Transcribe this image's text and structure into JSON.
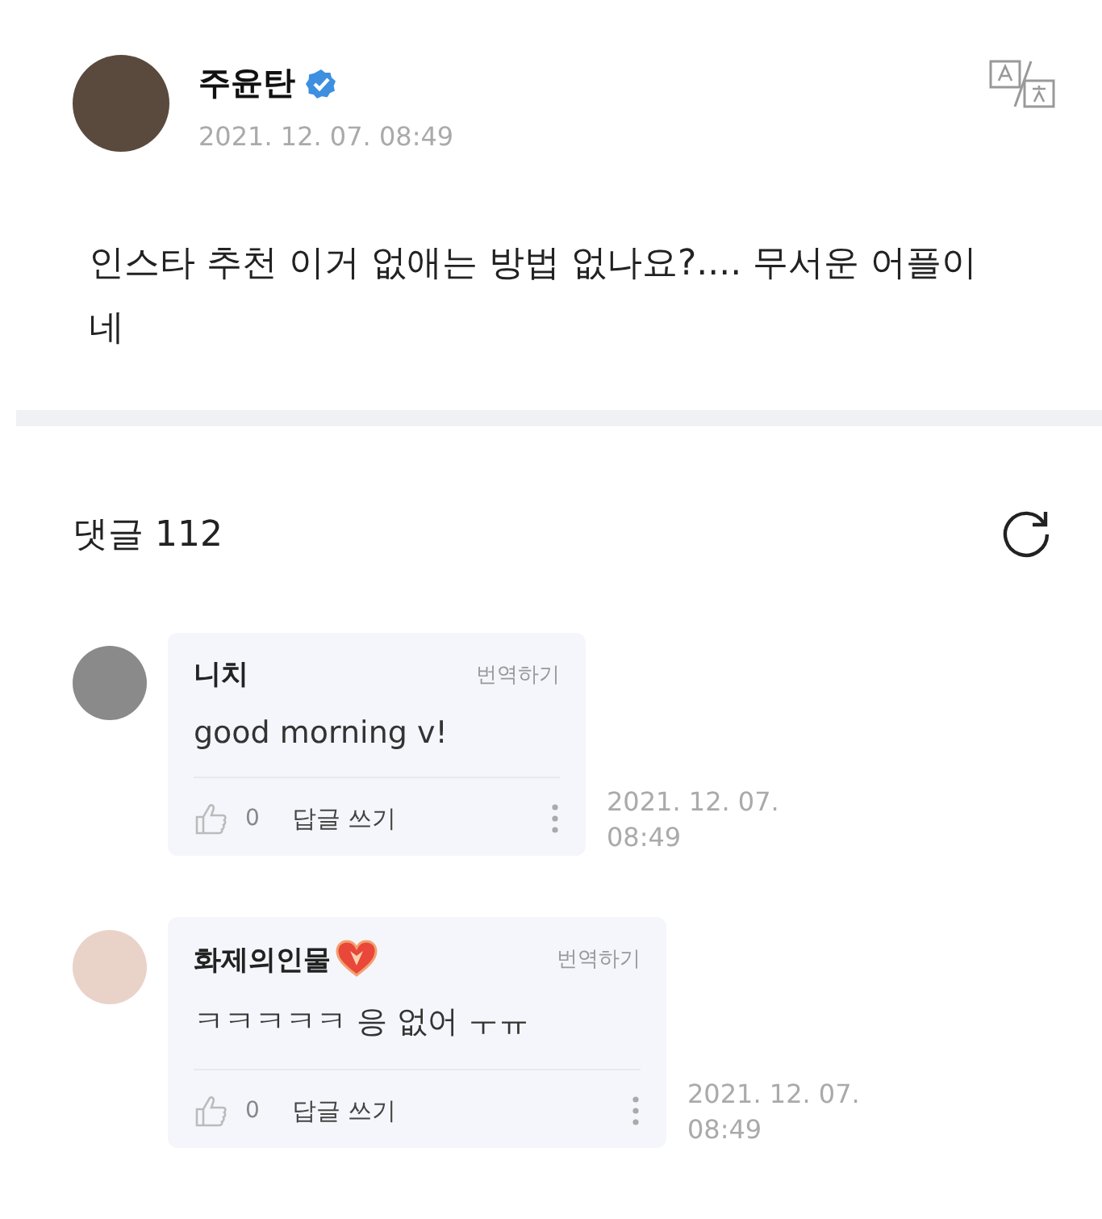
{
  "post": {
    "author": "주윤탄",
    "verified": true,
    "timestamp": "2021. 12. 07. 08:49",
    "text": "인스타 추천 이거 없애는 방법 없나요?.... 무서운 어플이네"
  },
  "comments_header": {
    "title": "댓글 112"
  },
  "comments": [
    {
      "author": "니치",
      "badge": false,
      "translate": "번역하기",
      "text": "good morning v!",
      "likes": "0",
      "reply": "답글 쓰기",
      "timestamp": "2021. 12. 07. 08:49"
    },
    {
      "author": "화제의인물",
      "badge": true,
      "translate": "번역하기",
      "text": "ㅋㅋㅋㅋㅋ 응 없어 ㅜㅠ",
      "likes": "0",
      "reply": "답글 쓰기",
      "timestamp": "2021. 12. 07. 08:49"
    }
  ]
}
